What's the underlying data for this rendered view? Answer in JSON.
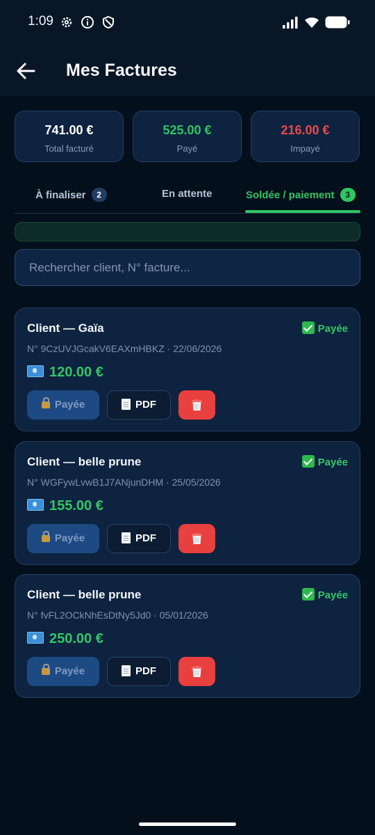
{
  "status_bar": {
    "time": "1:09"
  },
  "header": {
    "title": "Mes Factures"
  },
  "summary": [
    {
      "value": "741.00 €",
      "label": "Total facturé",
      "color": "#ffffff"
    },
    {
      "value": "525.00 €",
      "label": "Payé",
      "color": "#2fc562"
    },
    {
      "value": "216.00 €",
      "label": "Impayé",
      "color": "#ea4a48"
    }
  ],
  "tabs": [
    {
      "label": "À finaliser",
      "count": "2"
    },
    {
      "label": "En attente"
    },
    {
      "label": "Soldée / paiement",
      "count": "3",
      "active": true
    }
  ],
  "search": {
    "placeholder": "Rechercher client, N° facture..."
  },
  "invoices": [
    {
      "client": "Client — Gaïa",
      "status": "Payée",
      "meta": "N° 9CzUVJGcakV6EAXmHBKZ · 22/06/2026",
      "amount": "120.00 €",
      "paid_button": "Payée",
      "pdf_button": "PDF"
    },
    {
      "client": "Client — belle prune",
      "status": "Payée",
      "meta": "N° WGFywLvwB1J7ANjunDHM · 25/05/2026",
      "amount": "155.00 €",
      "paid_button": "Payée",
      "pdf_button": "PDF"
    },
    {
      "client": "Client — belle prune",
      "status": "Payée",
      "meta": "N° fvFL2OCkNhEsDtNy5Jd0 · 05/01/2026",
      "amount": "250.00 €",
      "paid_button": "Payée",
      "pdf_button": "PDF"
    }
  ]
}
